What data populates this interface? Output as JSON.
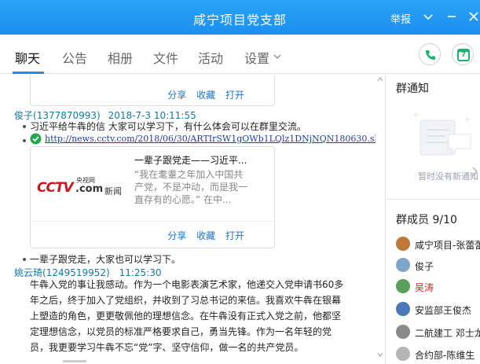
{
  "window": {
    "title": "咸宁项目党支部",
    "report_label": "举报"
  },
  "tabs": [
    {
      "label": "聊天"
    },
    {
      "label": "公告"
    },
    {
      "label": "相册"
    },
    {
      "label": "文件"
    },
    {
      "label": "活动"
    },
    {
      "label": "设置"
    }
  ],
  "toolbar": {
    "calendar_day": "7"
  },
  "chat": {
    "card1_actions": {
      "share": "分享",
      "favorite": "收藏",
      "open": "打开"
    },
    "msg1": {
      "sender": "俊子",
      "qq": "(1377870993)",
      "time": "2018-7-3  10:11:55",
      "line1": "习近平给牛犇的信   大家可以学习下，有什么体会可以在群里交流。",
      "link": "http://news.cctv.com/2018/06/30/ARTIrSW1gOWb1LQlz1DNjNQN180630.shtml",
      "card_title": "一辈子跟党走——习近平...",
      "card_desc_1": "“我在耄耋之年加入中国共",
      "card_desc_2": "产党，不是冲动，而是我一",
      "card_desc_3": "直存有的心愿。” 在中...",
      "logo_main": "CCTV",
      "logo_sub_top": "央视网",
      "logo_com": ".com",
      "logo_news": "新闻",
      "actions": {
        "share": "分享",
        "favorite": "收藏",
        "open": "打开"
      },
      "line2": "一辈子跟党走，大家也可以学习下。"
    },
    "msg2": {
      "sender": "姚云琦",
      "qq": "(1249519952)",
      "time": "11:25:30",
      "lines": [
        "牛犇入党的事让我感动。作为一个电影表演艺术家，他递交入党申请书60多",
        "年之后，终于加入了党组织，并收到了习总书记的来信。我喜欢牛犇在银幕",
        "上塑造的角色，更更敬佩他的理想信念。在牛犇没有正式入党之前，他都坚",
        "定理想信念，以党员的标准严格要求自己，勇当先锋。作为一名年轻的党",
        "员，我更要学习牛犇不忘“党”字、坚守信仰，做一名的共产党员。"
      ]
    }
  },
  "side": {
    "notice_title": "群通知",
    "notice_empty": "暂时没有新通知",
    "members_title": "群成员 9/10",
    "members": [
      {
        "name": "咸宁项目-张蕾蕾",
        "color": "#333333"
      },
      {
        "name": "俊子",
        "color": "#333333"
      },
      {
        "name": "吴涛",
        "color": "#e02020"
      },
      {
        "name": "安监部王俊杰",
        "color": "#333333"
      },
      {
        "name": "二航建工  邓士龙",
        "color": "#333333"
      },
      {
        "name": "合约部-陈维生",
        "color": "#333333"
      }
    ]
  }
}
